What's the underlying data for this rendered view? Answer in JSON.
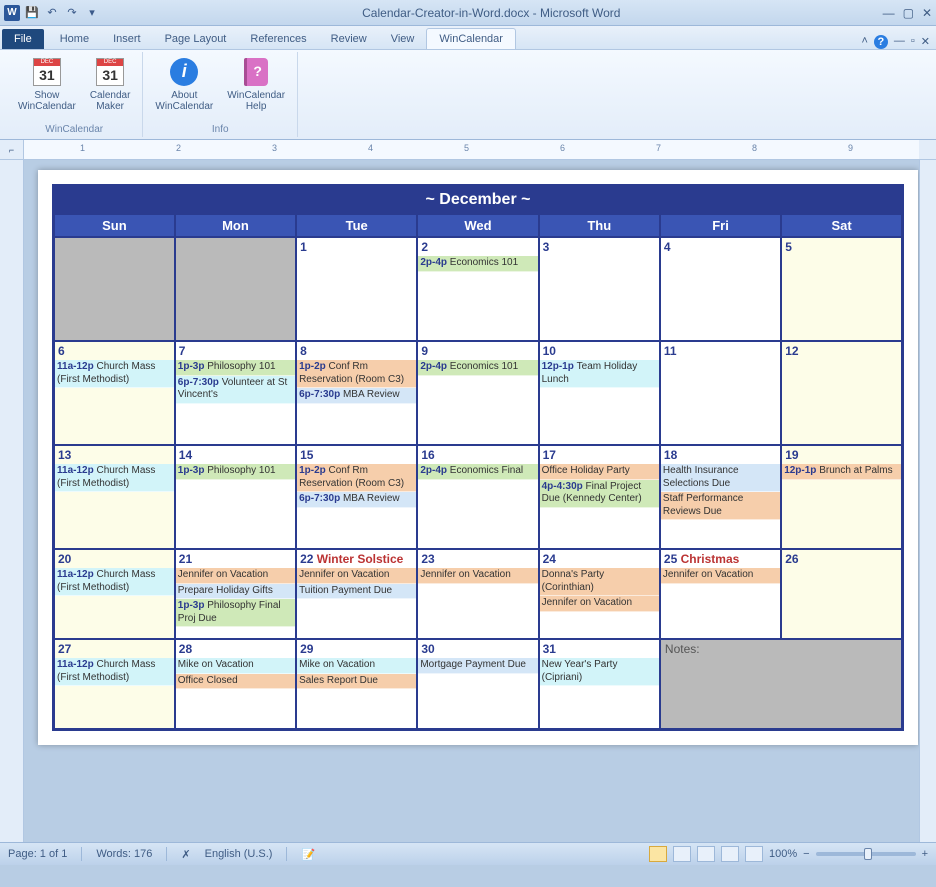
{
  "title": "Calendar-Creator-in-Word.docx - Microsoft Word",
  "tabs": {
    "file": "File",
    "home": "Home",
    "insert": "Insert",
    "pagelayout": "Page Layout",
    "references": "References",
    "review": "Review",
    "view": "View",
    "wincalendar": "WinCalendar"
  },
  "ribbon": {
    "group1_label": "WinCalendar",
    "group2_label": "Info",
    "show": "Show\nWinCalendar",
    "maker": "Calendar\nMaker",
    "about": "About\nWinCalendar",
    "help": "WinCalendar\nHelp"
  },
  "month_title": "~  December  ~",
  "days": [
    "Sun",
    "Mon",
    "Tue",
    "Wed",
    "Thu",
    "Fri",
    "Sat"
  ],
  "weeks": [
    [
      {
        "num": "",
        "bg": "bg-gray"
      },
      {
        "num": "",
        "bg": "bg-gray"
      },
      {
        "num": "1",
        "bg": ""
      },
      {
        "num": "2",
        "bg": "",
        "events": [
          {
            "t": "2p-4p",
            "txt": "Economics 101",
            "bg": "bg-green"
          }
        ]
      },
      {
        "num": "3",
        "bg": ""
      },
      {
        "num": "4",
        "bg": ""
      },
      {
        "num": "5",
        "bg": "bg-yel"
      }
    ],
    [
      {
        "num": "6",
        "bg": "bg-yel",
        "events": [
          {
            "t": "11a-12p",
            "txt": "Church Mass (First Methodist)",
            "bg": "bg-cyan"
          }
        ]
      },
      {
        "num": "7",
        "bg": "",
        "events": [
          {
            "t": "1p-3p",
            "txt": "Philosophy 101",
            "bg": "bg-green"
          },
          {
            "t": "6p-7:30p",
            "txt": "Volunteer at St Vincent's",
            "bg": "bg-cyan"
          }
        ]
      },
      {
        "num": "8",
        "bg": "",
        "events": [
          {
            "t": "1p-2p",
            "txt": "Conf Rm Reservation (Room C3)",
            "bg": "bg-orange"
          },
          {
            "t": "6p-7:30p",
            "txt": "MBA Review",
            "bg": "bg-blue"
          }
        ]
      },
      {
        "num": "9",
        "bg": "",
        "events": [
          {
            "t": "2p-4p",
            "txt": "Economics 101",
            "bg": "bg-green"
          }
        ]
      },
      {
        "num": "10",
        "bg": "",
        "events": [
          {
            "t": "12p-1p",
            "txt": "Team Holiday Lunch",
            "bg": "bg-cyan"
          }
        ]
      },
      {
        "num": "11",
        "bg": ""
      },
      {
        "num": "12",
        "bg": "bg-yel"
      }
    ],
    [
      {
        "num": "13",
        "bg": "bg-yel",
        "events": [
          {
            "t": "11a-12p",
            "txt": "Church Mass (First Methodist)",
            "bg": "bg-cyan"
          }
        ]
      },
      {
        "num": "14",
        "bg": "",
        "events": [
          {
            "t": "1p-3p",
            "txt": "Philosophy 101",
            "bg": "bg-green"
          }
        ]
      },
      {
        "num": "15",
        "bg": "",
        "events": [
          {
            "t": "1p-2p",
            "txt": "Conf Rm Reservation (Room C3)",
            "bg": "bg-orange"
          },
          {
            "t": "6p-7:30p",
            "txt": "MBA Review",
            "bg": "bg-blue"
          }
        ]
      },
      {
        "num": "16",
        "bg": "",
        "events": [
          {
            "t": "2p-4p",
            "txt": "Economics Final",
            "bg": "bg-green"
          }
        ]
      },
      {
        "num": "17",
        "bg": "",
        "events": [
          {
            "t": "",
            "txt": "Office Holiday Party",
            "bg": "bg-orange"
          },
          {
            "t": "4p-4:30p",
            "txt": "Final Project Due (Kennedy Center)",
            "bg": "bg-green"
          }
        ]
      },
      {
        "num": "18",
        "bg": "",
        "events": [
          {
            "t": "",
            "txt": "Health Insurance Selections Due",
            "bg": "bg-blue"
          },
          {
            "t": "",
            "txt": "Staff Performance Reviews Due",
            "bg": "bg-orange"
          }
        ]
      },
      {
        "num": "19",
        "bg": "bg-yel",
        "events": [
          {
            "t": "12p-1p",
            "txt": "Brunch at Palms",
            "bg": "bg-orange"
          }
        ]
      }
    ],
    [
      {
        "num": "20",
        "bg": "bg-yel",
        "events": [
          {
            "t": "11a-12p",
            "txt": "Church Mass (First Methodist)",
            "bg": "bg-cyan"
          }
        ]
      },
      {
        "num": "21",
        "bg": "",
        "events": [
          {
            "t": "",
            "txt": "Jennifer on Vacation",
            "bg": "bg-orange"
          },
          {
            "t": "",
            "txt": "Prepare Holiday Gifts",
            "bg": "bg-blue"
          },
          {
            "t": "1p-3p",
            "txt": "Philosophy Final Proj Due",
            "bg": "bg-green"
          }
        ]
      },
      {
        "num": "22",
        "bg": "",
        "holiday": "Winter Solstice",
        "events": [
          {
            "t": "",
            "txt": "Jennifer on Vacation",
            "bg": "bg-orange"
          },
          {
            "t": "",
            "txt": "Tuition Payment Due",
            "bg": "bg-blue"
          }
        ]
      },
      {
        "num": "23",
        "bg": "",
        "events": [
          {
            "t": "",
            "txt": "Jennifer on Vacation",
            "bg": "bg-orange"
          }
        ]
      },
      {
        "num": "24",
        "bg": "",
        "events": [
          {
            "t": "",
            "txt": "Donna's Party (Corinthian)",
            "bg": "bg-orange"
          },
          {
            "t": "",
            "txt": "Jennifer on Vacation",
            "bg": "bg-orange"
          }
        ]
      },
      {
        "num": "25",
        "bg": "",
        "holiday": "Christmas",
        "events": [
          {
            "t": "",
            "txt": "Jennifer on Vacation",
            "bg": "bg-orange"
          }
        ]
      },
      {
        "num": "26",
        "bg": "bg-yel"
      }
    ],
    [
      {
        "num": "27",
        "bg": "bg-yel",
        "events": [
          {
            "t": "11a-12p",
            "txt": "Church Mass (First Methodist)",
            "bg": "bg-cyan"
          }
        ]
      },
      {
        "num": "28",
        "bg": "",
        "events": [
          {
            "t": "",
            "txt": "Mike on Vacation",
            "bg": "bg-cyan"
          },
          {
            "t": "",
            "txt": "Office Closed",
            "bg": "bg-orange"
          }
        ]
      },
      {
        "num": "29",
        "bg": "",
        "events": [
          {
            "t": "",
            "txt": "Mike on Vacation",
            "bg": "bg-cyan"
          },
          {
            "t": "",
            "txt": "Sales Report Due",
            "bg": "bg-orange"
          }
        ]
      },
      {
        "num": "30",
        "bg": "",
        "events": [
          {
            "t": "",
            "txt": "Mortgage Payment Due",
            "bg": "bg-blue"
          }
        ]
      },
      {
        "num": "31",
        "bg": "",
        "events": [
          {
            "t": "",
            "txt": "New Year's Party (Cipriani)",
            "bg": "bg-cyan"
          }
        ]
      },
      {
        "num": "Notes:",
        "bg": "bg-gray",
        "notes": true
      },
      {
        "num": "",
        "bg": "bg-gray",
        "merge": true
      }
    ]
  ],
  "status": {
    "page": "Page: 1 of 1",
    "words": "Words: 176",
    "lang": "English (U.S.)",
    "zoom": "100%"
  }
}
